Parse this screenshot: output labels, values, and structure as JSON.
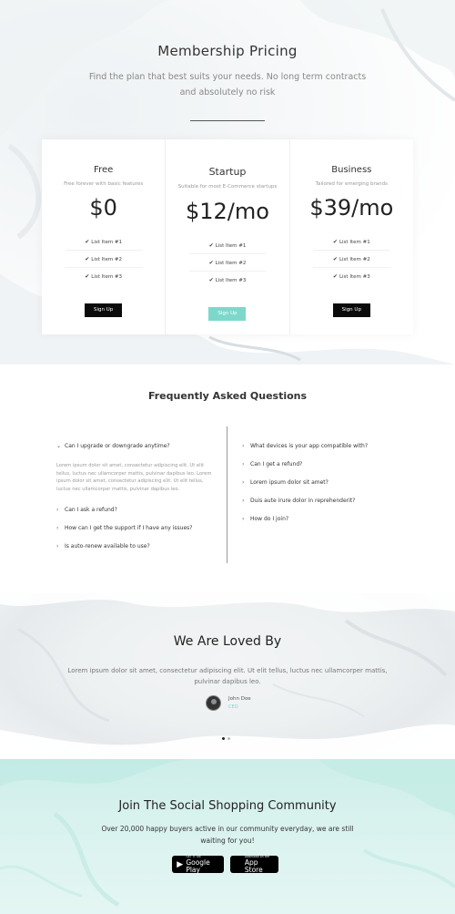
{
  "pricing": {
    "title": "Membership Pricing",
    "subtitle": "Find the plan that best suits your needs. No long term contracts and absolutely no risk",
    "plans": [
      {
        "name": "Free",
        "desc": "Free forever with basic features",
        "price": "$0",
        "items": [
          "List Item #1",
          "List Item #2",
          "List Item #3"
        ],
        "button": "Sign Up",
        "button_style": "dark"
      },
      {
        "name": "Startup",
        "desc": "Suitable for most E-Commerce startups",
        "price": "$12/mo",
        "items": [
          "List Item #1",
          "List Item #2",
          "List Item #3"
        ],
        "button": "Sign Up",
        "button_style": "teal"
      },
      {
        "name": "Business",
        "desc": "Tailored for emerging brands",
        "price": "$39/mo",
        "items": [
          "List Item #1",
          "List Item #2",
          "List Item #3"
        ],
        "button": "Sign Up",
        "button_style": "dark"
      }
    ]
  },
  "faq": {
    "title": "Frequently Asked Questions",
    "left": [
      {
        "question": "Can I upgrade or downgrade anytime?",
        "expanded": true,
        "answer": "Lorem ipsum dolor sit amet, consectetur adipiscing elit. Ut elit tellus, luctus nec ullamcorper mattis, pulvinar dapibus leo. Lorem ipsum dolor sit amet, consectetur adipiscing elit. Ut elit tellus, luctus nec ullamcorper mattis, pulvinar dapibus leo."
      },
      {
        "question": "Can I ask a refund?",
        "expanded": false
      },
      {
        "question": "How can I get the support if I have any issues?",
        "expanded": false
      },
      {
        "question": "Is auto-renew available to use?",
        "expanded": false
      }
    ],
    "right": [
      {
        "question": "What devices is your app compatible with?",
        "expanded": false
      },
      {
        "question": "Can I get a refund?",
        "expanded": false
      },
      {
        "question": "Lorem ipsum dolor sit amet?",
        "expanded": false
      },
      {
        "question": "Duis aute irure dolor in reprehenderit?",
        "expanded": false
      },
      {
        "question": "How do I join?",
        "expanded": false
      }
    ]
  },
  "testimonials": {
    "title": "We Are Loved By",
    "quote": "Lorem ipsum dolor sit amet, consectetur adipiscing elit. Ut elit tellus, luctus nec ullamcorper mattis, pulvinar dapibus leo.",
    "name": "John Doe",
    "role": "CEO",
    "slide_count": 2,
    "active_slide": 1
  },
  "community": {
    "title": "Join The Social Shopping Community",
    "description": "Over 20,000 happy buyers active in our community everyday, we are still waiting for you!",
    "google_play": {
      "small": "GET IT ON",
      "big": "Google Play",
      "icon": "google-play-icon"
    },
    "app_store": {
      "small": "Download on the",
      "big": "App Store",
      "icon": "apple-icon"
    }
  },
  "colors": {
    "accent": "#7dd8cb",
    "button_dark": "#0b0b0b",
    "community_bg": "#d3f0ec"
  }
}
